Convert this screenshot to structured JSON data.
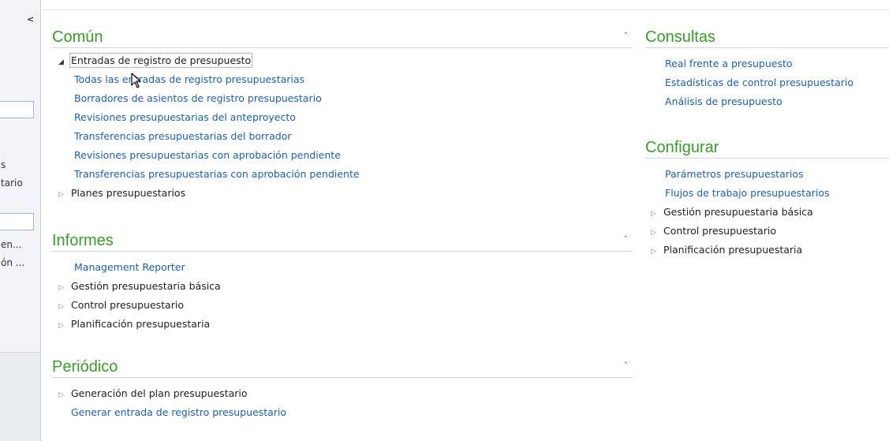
{
  "nav": {
    "collapse_glyph": "<",
    "trunc_items": [
      "s",
      "tario",
      "en...",
      "ón ..."
    ]
  },
  "groups": {
    "comun": {
      "title": "Común",
      "tree": {
        "label": "Entradas de registro de presupuesto",
        "children": [
          "Todas las entradas de registro presupuestarias",
          "Borradores de asientos de registro presupuestario",
          "Revisiones presupuestarias del anteproyecto",
          "Transferencias presupuestarias del borrador",
          "Revisiones presupuestarias con aprobación pendiente",
          "Transferencias presupuestarias con aprobación pendiente"
        ]
      },
      "collapsed": "Planes presupuestarios"
    },
    "informes": {
      "title": "Informes",
      "link": "Management Reporter",
      "nodes": [
        "Gestión presupuestaria básica",
        "Control presupuestario",
        "Planificación presupuestaria"
      ]
    },
    "periodico": {
      "title": "Periódico",
      "node": "Generación del plan presupuestario",
      "link": "Generar entrada de registro presupuestario"
    },
    "consultas": {
      "title": "Consultas",
      "links": [
        "Real frente a presupuesto",
        "Estadísticas de control presupuestario",
        "Análisis de presupuesto"
      ]
    },
    "configurar": {
      "title": "Configurar",
      "links": [
        "Parámetros presupuestarios",
        "Flujos de trabajo presupuestarios"
      ],
      "nodes": [
        "Gestión presupuestaria básica",
        "Control presupuestario",
        "Planificación presupuestaria"
      ]
    }
  },
  "icons": {
    "collapse": "˄",
    "expanded": "◢",
    "collapsed": "▷"
  }
}
